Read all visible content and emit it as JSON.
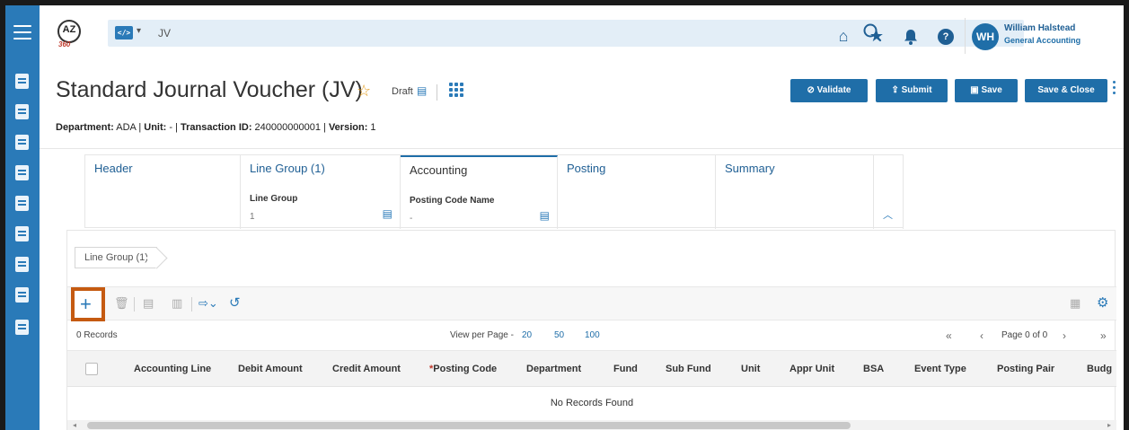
{
  "app": {
    "logo_text": "AZ",
    "logo_sub": "360",
    "search_value": "JV",
    "search_type_icon": "code-icon",
    "user_initials": "WH",
    "user_name": "William Halstead",
    "user_role": "General Accounting"
  },
  "page": {
    "title": "Standard Journal Voucher (JV)",
    "status": "Draft",
    "meta": {
      "department_label": "Department:",
      "department_value": "ADA",
      "unit_label": "Unit:",
      "unit_value": "-",
      "txn_label": "Transaction ID:",
      "txn_value": "240000000001",
      "version_label": "Version:",
      "version_value": "1"
    },
    "actions": {
      "validate": "Validate",
      "submit": "Submit",
      "save": "Save",
      "save_close": "Save & Close"
    }
  },
  "tabs": [
    {
      "label": "Header"
    },
    {
      "label": "Line Group (1)",
      "sub_label": "Line Group",
      "sub_value": "1"
    },
    {
      "label": "Accounting",
      "sub_label": "Posting Code Name",
      "sub_value": "-"
    },
    {
      "label": "Posting"
    },
    {
      "label": "Summary"
    }
  ],
  "grid": {
    "breadcrumb": "Line Group (1)",
    "records": "0 Records",
    "view_per_page_label": "View per Page -",
    "page_sizes": [
      "20",
      "50",
      "100"
    ],
    "page_info": "Page 0 of 0",
    "columns": [
      "Accounting Line",
      "Debit Amount",
      "Credit Amount",
      "Posting Code",
      "Department",
      "Fund",
      "Sub Fund",
      "Unit",
      "Appr Unit",
      "BSA",
      "Event Type",
      "Posting Pair",
      "Budg"
    ],
    "required_marker": "*",
    "empty_text": "No Records Found"
  },
  "colors": {
    "rail": "#2a7ab8",
    "primary": "#1f6ea8",
    "highlight": "#c55a11",
    "star": "#e39c1d"
  }
}
